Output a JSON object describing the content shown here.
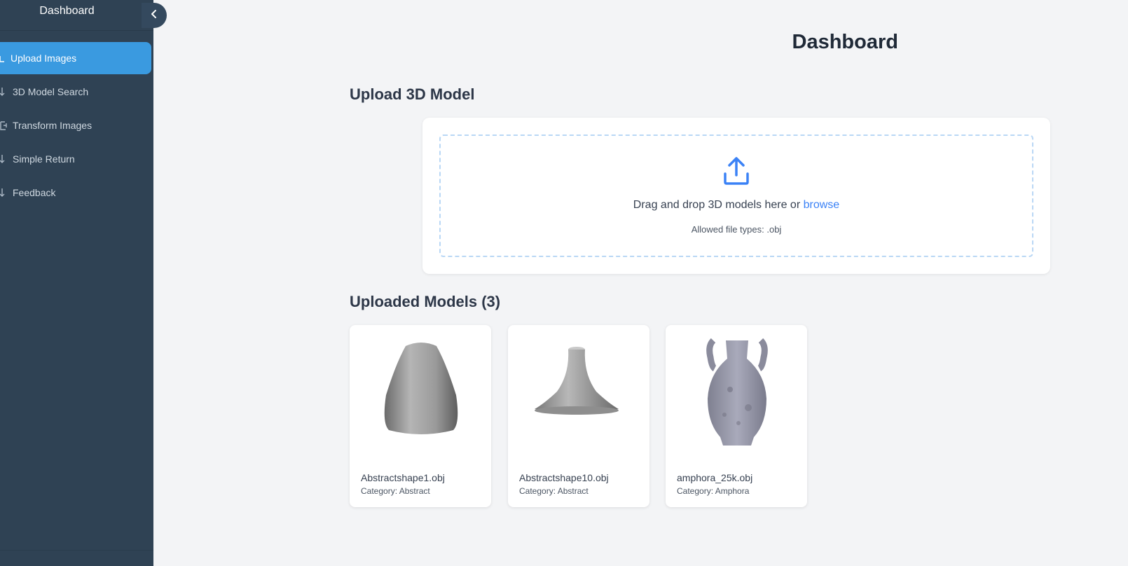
{
  "sidebar": {
    "title": "Dashboard",
    "items": [
      {
        "label": "Upload Images",
        "icon": "upload-icon",
        "active": true
      },
      {
        "label": "3D Model Search",
        "icon": "arrow-icon",
        "active": false
      },
      {
        "label": "Transform Images",
        "icon": "transform-icon",
        "active": false
      },
      {
        "label": "Simple Return",
        "icon": "arrow-icon",
        "active": false
      },
      {
        "label": "Feedback",
        "icon": "arrow-icon",
        "active": false
      }
    ]
  },
  "page": {
    "title": "Dashboard"
  },
  "upload": {
    "section_title": "Upload 3D Model",
    "drop_text": "Drag and drop 3D models here or",
    "browse_label": "browse",
    "allowed_types": "Allowed file types: .obj"
  },
  "models": {
    "section_title": "Uploaded Models (3)",
    "items": [
      {
        "name": "Abstractshape1.obj",
        "category": "Category: Abstract"
      },
      {
        "name": "Abstractshape10.obj",
        "category": "Category: Abstract"
      },
      {
        "name": "amphora_25k.obj",
        "category": "Category: Amphora"
      }
    ]
  },
  "colors": {
    "sidebar_bg": "#2f4254",
    "active_item": "#3a9ae0",
    "accent": "#3b82f6",
    "page_bg": "#f3f4f6"
  }
}
